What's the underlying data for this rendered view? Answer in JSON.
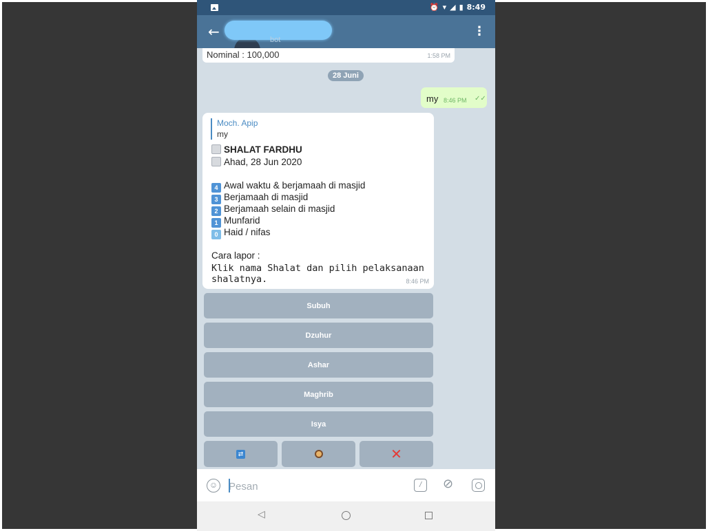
{
  "status_bar": {
    "icons": [
      "gallery-icon",
      "alarm-icon",
      "wifi-icon",
      "signal-icon",
      "battery-icon"
    ],
    "time": "8:49"
  },
  "app_bar": {
    "subtitle": "bot",
    "name_redacted": true
  },
  "chat": {
    "previous_message": {
      "text": "Nominal : 100,000",
      "time": "1:58 PM"
    },
    "date_separator": "28 Juni",
    "outgoing": {
      "text": "my",
      "time": "8:46 PM"
    },
    "incoming": {
      "reply_to_name": "Moch. Apip",
      "reply_to_text": "my",
      "title": "SHALAT FARDHU",
      "date": "Ahad, 28 Jun 2020",
      "options": [
        {
          "num": "4",
          "label": "Awal waktu & berjamaah di masjid"
        },
        {
          "num": "3",
          "label": "Berjamaah di masjid"
        },
        {
          "num": "2",
          "label": "Berjamaah selain di masjid"
        },
        {
          "num": "1",
          "label": "Munfarid"
        },
        {
          "num": "0",
          "label": "Haid / nifas"
        }
      ],
      "instruction_label": "Cara lapor :",
      "instruction_line1": "Klik nama Shalat dan pilih pelaksanaan",
      "instruction_line2": "shalatnya.",
      "time": "8:46 PM"
    }
  },
  "keyboard": {
    "buttons": [
      "Subuh",
      "Dzuhur",
      "Ashar",
      "Maghrib",
      "Isya"
    ],
    "bottom_row": [
      "swap-icon",
      "person-icon",
      "close-icon"
    ],
    "bottom_row_glyphs": [
      "⇄",
      "",
      "✕"
    ]
  },
  "input_bar": {
    "placeholder": "Pesan"
  },
  "colors": {
    "status_bar": "#2f5579",
    "app_bar": "#4a7397",
    "chat_bg": "#d3dde5",
    "outgoing_bubble": "#e2fdc9",
    "keyboard_button": "#a2b1bf",
    "accent": "#4a8bc3"
  }
}
